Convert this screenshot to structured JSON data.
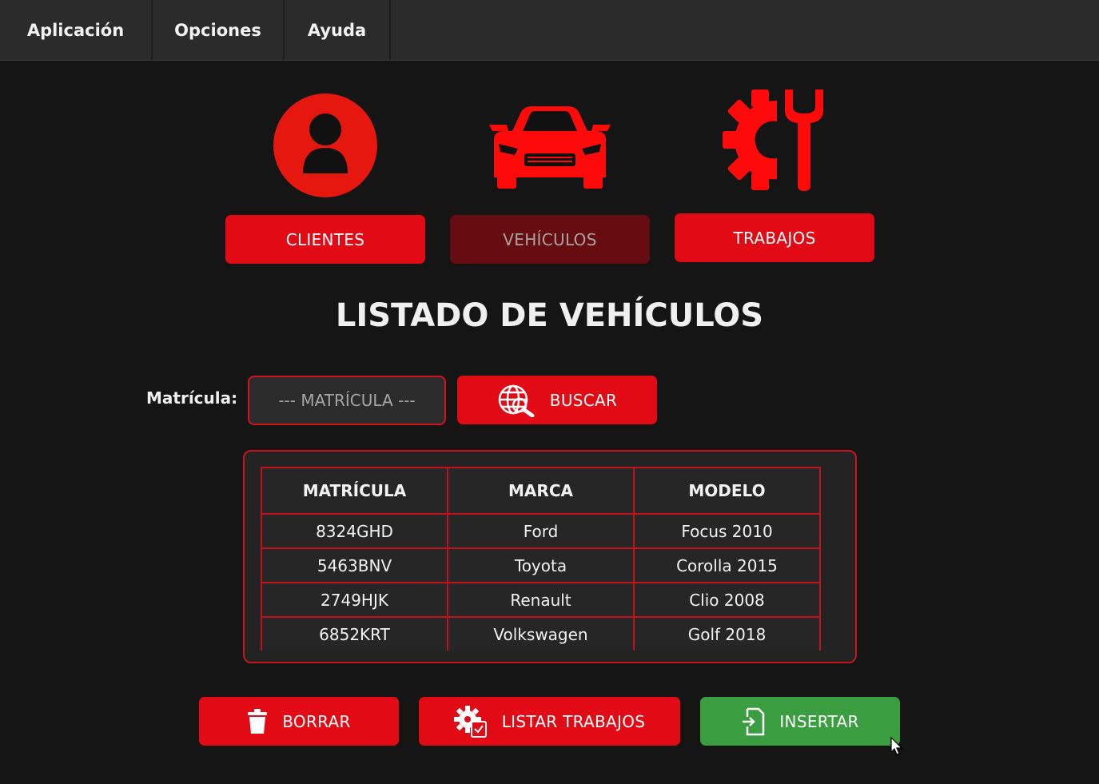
{
  "menubar": {
    "items": [
      "Aplicación",
      "Opciones",
      "Ayuda"
    ]
  },
  "nav": {
    "clientes_label": "CLIENTES",
    "vehiculos_label": "VEHÍCULOS",
    "trabajos_label": "TRABAJOS",
    "active": "VEHÍCULOS"
  },
  "page": {
    "title": "LISTADO DE VEHÍCULOS"
  },
  "search": {
    "label": "Matrícula:",
    "placeholder": "--- MATRÍCULA ---",
    "button_label": "BUSCAR"
  },
  "table": {
    "headers": [
      "MATRÍCULA",
      "MARCA",
      "MODELO"
    ],
    "rows": [
      [
        "8324GHD",
        "Ford",
        "Focus 2010"
      ],
      [
        "5463BNV",
        "Toyota",
        "Corolla 2015"
      ],
      [
        "2749HJK",
        "Renault",
        "Clio 2008"
      ],
      [
        "6852KRT",
        "Volkswagen",
        "Golf 2018"
      ]
    ]
  },
  "actions": {
    "borrar_label": "BORRAR",
    "listar_label": "LISTAR TRABAJOS",
    "insertar_label": "INSERTAR"
  },
  "colors": {
    "accent_red": "#e20a15",
    "inactive_red": "#670c11",
    "insert_green": "#3a9d3f",
    "background": "#151516",
    "menubar": "#2b2b2b"
  },
  "icons": [
    "user-icon",
    "car-icon",
    "gear-wrench-icon",
    "globe-search-icon",
    "trash-icon",
    "gear-list-icon",
    "document-insert-icon"
  ]
}
